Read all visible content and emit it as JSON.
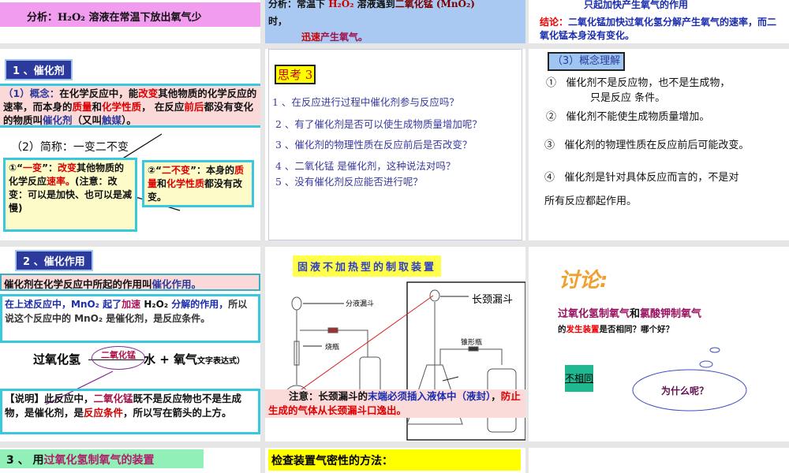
{
  "top": {
    "s1": [
      {
        "t": "分析：H₂O₂ 溶液在常温下放出氧气少",
        "c": "#111"
      }
    ],
    "s2a": [
      {
        "t": "分析：常温下 ",
        "c": "#111"
      },
      {
        "t": "H₂O₂",
        "c": "#c00"
      },
      {
        "t": " 溶液遇到",
        "c": "#111"
      },
      {
        "t": "二氧化锰 (MnO₂)",
        "c": "#7a0000"
      }
    ],
    "s2b": "时，",
    "s2c": [
      {
        "t": "迅速",
        "c": "#c00"
      },
      {
        "t": "产生氧气。",
        "c": "#a0104a"
      }
    ],
    "s3a": "只起加快产生氧气的作用",
    "s3b": [
      {
        "t": "结论：",
        "c": "#e00"
      },
      {
        "t": "二氧化锰加快过氧化氢分解产生氧气的速率，而二氧化锰本身没有变化。",
        "c": "#1a2cb0"
      }
    ]
  },
  "catalyst": {
    "label": "1 、催化剂",
    "concept": [
      {
        "t": "（1）概念：",
        "c": "#2b3a9c"
      },
      {
        "t": "在化学反应中，能",
        "c": "#111"
      },
      {
        "t": "改变",
        "c": "#d00"
      },
      {
        "t": "其他物质的化学反应的速率，而本身的",
        "c": "#111"
      },
      {
        "t": "质量",
        "c": "#d00"
      },
      {
        "t": "和",
        "c": "#111"
      },
      {
        "t": "化学性质",
        "c": "#d00"
      },
      {
        "t": "， 在反应",
        "c": "#111"
      },
      {
        "t": "前后",
        "c": "#d00"
      },
      {
        "t": "都没有变化的物质叫",
        "c": "#111"
      },
      {
        "t": "催化剂",
        "c": "#2b3a9c"
      },
      {
        "t": "（又叫",
        "c": "#111"
      },
      {
        "t": "触媒",
        "c": "#2b3a9c"
      },
      {
        "t": "）。",
        "c": "#111"
      }
    ],
    "short": "（2）简称：一变二不变",
    "box1": [
      {
        "t": "①“",
        "c": "#111"
      },
      {
        "t": "一变",
        "c": "#d00"
      },
      {
        "t": "”：",
        "c": "#111"
      },
      {
        "t": "改变",
        "c": "#d00"
      },
      {
        "t": "其他物质的化学反应",
        "c": "#111"
      },
      {
        "t": "速率。",
        "c": "#d00"
      },
      {
        "t": "(注意：改变：可以是加快、也可以是减慢)",
        "c": "#111"
      }
    ],
    "box2": [
      {
        "t": "②“",
        "c": "#111"
      },
      {
        "t": "二不变",
        "c": "#d00"
      },
      {
        "t": "”：本身的",
        "c": "#111"
      },
      {
        "t": "质量",
        "c": "#d00"
      },
      {
        "t": "和",
        "c": "#111"
      },
      {
        "t": "化学性质",
        "c": "#d00"
      },
      {
        "t": "都没有改变。",
        "c": "#111"
      }
    ]
  },
  "think": {
    "title": "思考 3",
    "questions": [
      "1 、在反应进行过程中催化剂参与反应吗？",
      "2 、有了催化剂是否可以使生成物质量增加呢？",
      "3 、催化剂的物理性质在反应前后是否改变？",
      "4 、二氧化锰 是催化剂，这种说法对吗？",
      "5 、没有催化剂反应能否进行呢？"
    ]
  },
  "understand": {
    "title": "（3）概念理解",
    "items": [
      {
        "n": "①",
        "t": "催化剂不是反应物，也不是生成物，",
        "t2": "只是反应 条件。"
      },
      {
        "n": "②",
        "t": "催化剂不能使生成物质量增加。"
      },
      {
        "n": "③",
        "t": "催化剂的物理性质在反应前后可能改变。"
      },
      {
        "n": "④",
        "t": "催化剂是针对具体反应而言的，不是对",
        "t2": "所有反应都起作用。"
      }
    ]
  },
  "action": {
    "label": "2 、催化作用",
    "def": [
      {
        "t": "催化剂在化学反应中所起的作用叫",
        "c": "#111"
      },
      {
        "t": "催化作用。",
        "c": "#2b3a9c"
      }
    ],
    "box": [
      {
        "t": "在上述反应中，MnO₂ 起了",
        "c": "#1a2cb0"
      },
      {
        "t": "加速",
        "c": "#b0105a"
      },
      {
        "t": " H₂O₂ ",
        "c": "#111"
      },
      {
        "t": "分解的作用，",
        "c": "#1a2cb0"
      },
      {
        "t": "所以说这个反应中的 MnO₂ 是催化剂，是反应条件。",
        "c": "#333"
      }
    ],
    "eq_left": "过氧化氢",
    "eq_cat": "二氧化锰",
    "eq_right": "水 + 氧气",
    "eq_note": "文字表达式）",
    "note": [
      {
        "t": "【说明】此反应中，",
        "c": "#111"
      },
      {
        "t": "二氧化锰",
        "c": "#a0104a"
      },
      {
        "t": "既不是反应物也不是生成物，是催化剂，是",
        "c": "#111"
      },
      {
        "t": "反应条件",
        "c": "#c00"
      },
      {
        "t": "，所以写在箭头的上方。",
        "c": "#111"
      }
    ]
  },
  "apparatus": {
    "title": "固液不加热型的制取装置",
    "labels": {
      "sep": "分液漏斗",
      "flask": "烧瓶",
      "long": "长颈漏斗",
      "cone": "锥形瓶"
    },
    "note": [
      {
        "t": "注意：长颈漏斗的",
        "c": "#111"
      },
      {
        "t": "末端必须插入液体中（液封）",
        "c": "#1a2cb0"
      },
      {
        "t": "，",
        "c": "#111"
      },
      {
        "t": "防止生成的气体从长颈漏斗口逸出。",
        "c": "#d00"
      }
    ]
  },
  "discuss": {
    "title": "讨论:",
    "q1": [
      {
        "t": "过氧化氢制氧气",
        "c": "#9a1060"
      },
      {
        "t": "和",
        "c": "#111"
      },
      {
        "t": "氯酸钾制氧气",
        "c": "#9a1060"
      }
    ],
    "q2": [
      {
        "t": "的",
        "c": "#111"
      },
      {
        "t": "发生装置",
        "c": "#e00"
      },
      {
        "t": "是否相同？哪个好？",
        "c": "#111"
      }
    ],
    "answer": "不相同",
    "why": "为什么呢？"
  },
  "bottom": {
    "s1": [
      {
        "t": "3 、 用",
        "c": "#111"
      },
      {
        "t": "过氧化氢制氧气的装置",
        "c": "#b0206a"
      }
    ],
    "s2": "检查装置气密性的方法："
  }
}
